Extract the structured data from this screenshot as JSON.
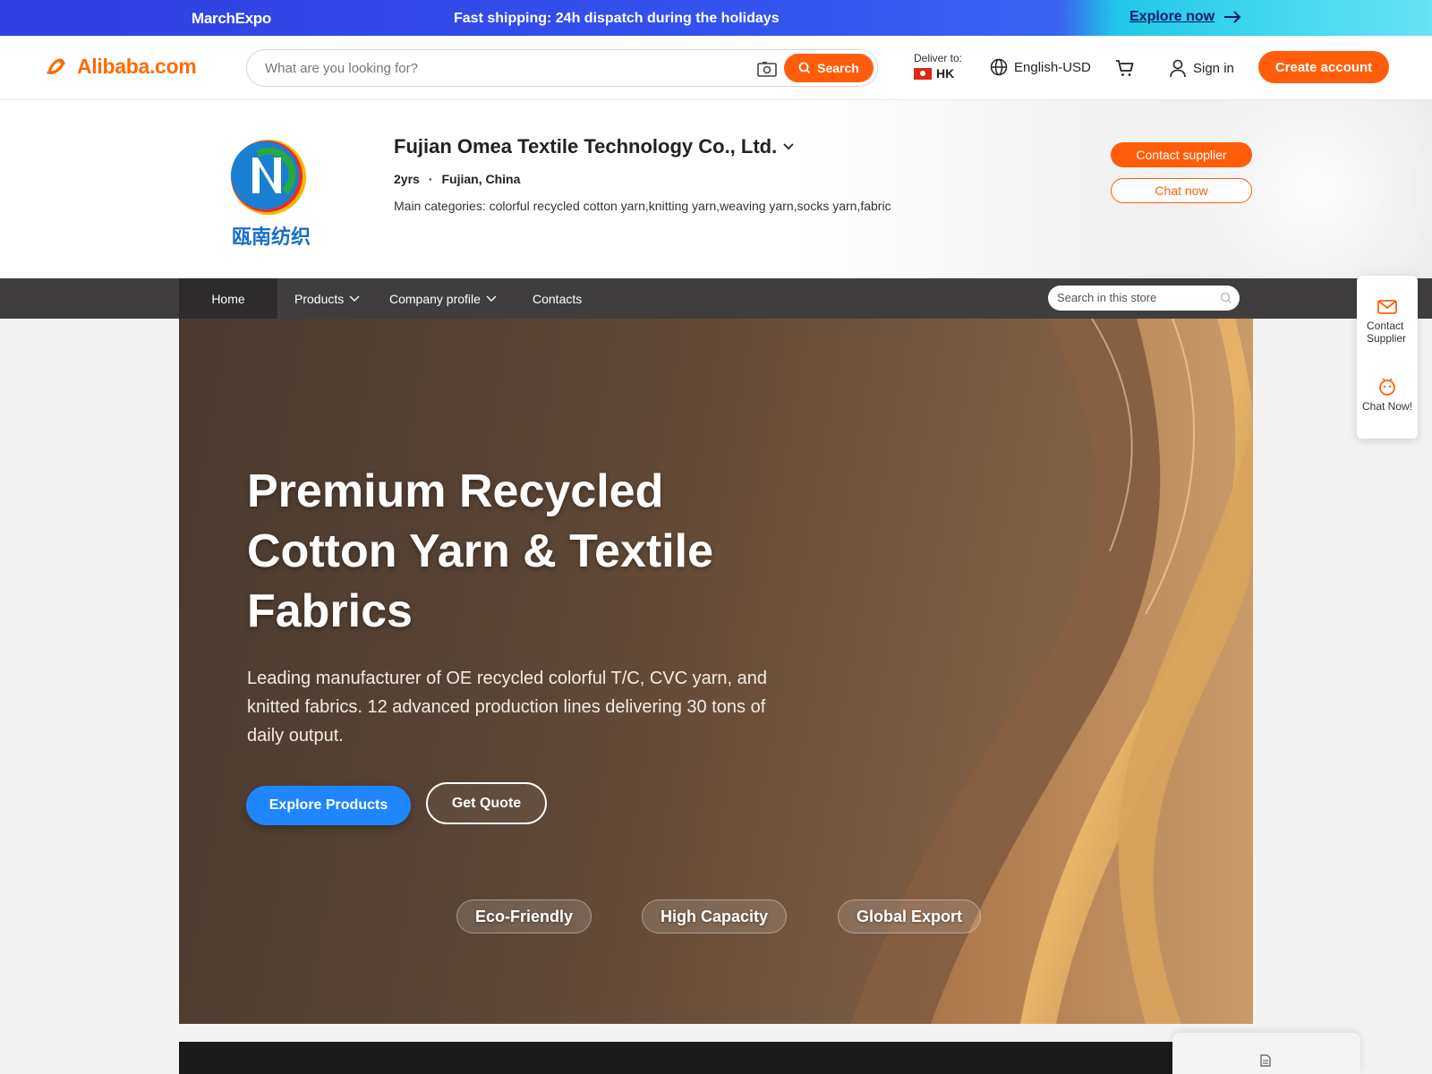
{
  "promo": {
    "brand": "MarchExpo",
    "message": "Fast shipping: 24h dispatch during the holidays",
    "cta": "Explore now"
  },
  "header": {
    "logo_text": "Alibaba.com",
    "search_placeholder": "What are you looking for?",
    "search_button": "Search",
    "deliver_label": "Deliver to:",
    "deliver_value": "HK",
    "language": "English-USD",
    "sign_in": "Sign in",
    "create_account": "Create account"
  },
  "supplier": {
    "logo_caption": "瓯南纺织",
    "name": "Fujian Omea Textile Technology Co., Ltd.",
    "years": "2yrs",
    "location": "Fujian, China",
    "main_categories": "Main categories: colorful recycled cotton yarn,knitting yarn,weaving yarn,socks yarn,fabric",
    "contact_button": "Contact supplier",
    "chat_button": "Chat now"
  },
  "nav": {
    "items": [
      {
        "label": "Home"
      },
      {
        "label": "Products"
      },
      {
        "label": "Company profile"
      },
      {
        "label": "Contacts"
      }
    ],
    "store_search_placeholder": "Search in this store"
  },
  "hero": {
    "title": "Premium Recycled Cotton Yarn & Textile Fabrics",
    "subtitle": "Leading manufacturer of OE recycled colorful T/C, CVC yarn, and knitted fabrics. 12 advanced production lines delivering 30 tons of daily output.",
    "primary_button": "Explore Products",
    "secondary_button": "Get Quote",
    "badges": [
      "Eco-Friendly",
      "High Capacity",
      "Global Export"
    ]
  },
  "side_panel": {
    "contact_label": "Contact Supplier",
    "chat_label": "Chat Now!"
  },
  "colors": {
    "brand_orange": "#ff5d0b",
    "nav_dark": "#3f3d3d",
    "hero_button_blue": "#1f86ff"
  }
}
